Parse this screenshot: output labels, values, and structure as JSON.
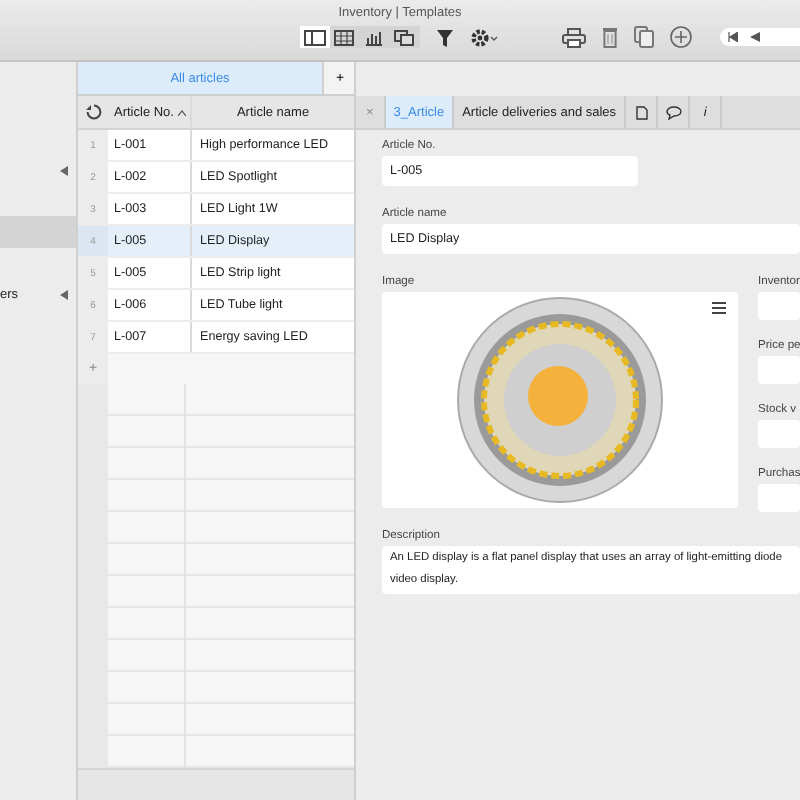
{
  "window": {
    "title": "Inventory | Templates"
  },
  "toolbar": {
    "view_buttons": [
      {
        "selected": true
      },
      {
        "selected": false
      },
      {
        "selected": false
      },
      {
        "selected": false
      }
    ],
    "pager": {
      "shown": true
    }
  },
  "sidebar": {
    "items": [
      {
        "selected": false,
        "has_arrow": true
      },
      {
        "selected": true,
        "has_arrow": false
      },
      {
        "label": "ers",
        "selected": false,
        "has_arrow": true
      }
    ]
  },
  "grid": {
    "tabs": [
      {
        "label": "All articles",
        "selected": true
      }
    ],
    "add_tab": "+",
    "columns": [
      {
        "label": "Article No.",
        "sorted": true
      },
      {
        "label": "Article name",
        "sorted": false
      }
    ],
    "rows": [
      {
        "number": "1",
        "article_no": "L-001",
        "name": "High performance LED",
        "selected": false
      },
      {
        "number": "2",
        "article_no": "L-002",
        "name": "LED Spotlight",
        "selected": false
      },
      {
        "number": "3",
        "article_no": "L-003",
        "name": "LED Light 1W",
        "selected": false
      },
      {
        "number": "4",
        "article_no": "L-005",
        "name": "LED Display",
        "selected": true
      },
      {
        "number": "5",
        "article_no": "L-005",
        "name": "LED Strip light",
        "selected": false
      },
      {
        "number": "6",
        "article_no": "L-006",
        "name": "LED Tube light",
        "selected": false
      },
      {
        "number": "7",
        "article_no": "L-007",
        "name": "Energy saving LED",
        "selected": false
      }
    ],
    "add_row": "+"
  },
  "detail": {
    "close": "×",
    "tabs": [
      {
        "kind": "text",
        "label": "3_Article",
        "selected": true
      },
      {
        "kind": "text",
        "label": "Article deliveries and sales",
        "selected": false
      },
      {
        "kind": "icon",
        "selected": false
      },
      {
        "kind": "icon",
        "selected": false
      },
      {
        "kind": "char",
        "label": "i",
        "selected": false
      }
    ],
    "fields": [
      {
        "label": "Article No.",
        "value": "L-005"
      },
      {
        "label": "Article name",
        "value": "LED Display"
      }
    ],
    "image": {
      "label": "Image"
    },
    "side_fields": [
      {
        "label": "Inventor"
      },
      {
        "label": "Price pe"
      },
      {
        "label": "Stock v"
      },
      {
        "label": "Purchas"
      }
    ],
    "description": {
      "label": "Description",
      "lines": [
        "An LED display is a flat panel display that uses an array of light-emitting diode",
        "video display."
      ]
    }
  }
}
